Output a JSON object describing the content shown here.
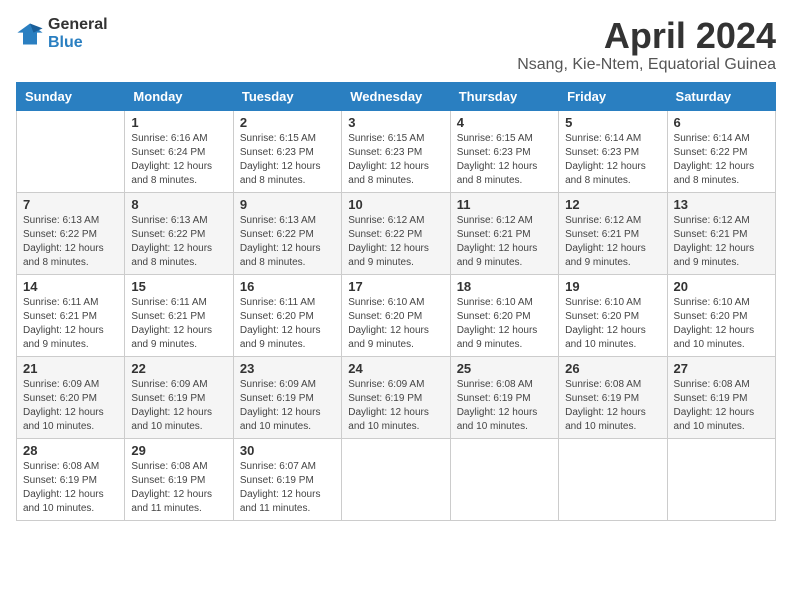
{
  "header": {
    "logo": {
      "line1": "General",
      "line2": "Blue"
    },
    "title": "April 2024",
    "location": "Nsang, Kie-Ntem, Equatorial Guinea"
  },
  "days_of_week": [
    "Sunday",
    "Monday",
    "Tuesday",
    "Wednesday",
    "Thursday",
    "Friday",
    "Saturday"
  ],
  "weeks": [
    [
      {
        "day": "",
        "info": ""
      },
      {
        "day": "1",
        "info": "Sunrise: 6:16 AM\nSunset: 6:24 PM\nDaylight: 12 hours\nand 8 minutes."
      },
      {
        "day": "2",
        "info": "Sunrise: 6:15 AM\nSunset: 6:23 PM\nDaylight: 12 hours\nand 8 minutes."
      },
      {
        "day": "3",
        "info": "Sunrise: 6:15 AM\nSunset: 6:23 PM\nDaylight: 12 hours\nand 8 minutes."
      },
      {
        "day": "4",
        "info": "Sunrise: 6:15 AM\nSunset: 6:23 PM\nDaylight: 12 hours\nand 8 minutes."
      },
      {
        "day": "5",
        "info": "Sunrise: 6:14 AM\nSunset: 6:23 PM\nDaylight: 12 hours\nand 8 minutes."
      },
      {
        "day": "6",
        "info": "Sunrise: 6:14 AM\nSunset: 6:22 PM\nDaylight: 12 hours\nand 8 minutes."
      }
    ],
    [
      {
        "day": "7",
        "info": "Sunrise: 6:13 AM\nSunset: 6:22 PM\nDaylight: 12 hours\nand 8 minutes."
      },
      {
        "day": "8",
        "info": "Sunrise: 6:13 AM\nSunset: 6:22 PM\nDaylight: 12 hours\nand 8 minutes."
      },
      {
        "day": "9",
        "info": "Sunrise: 6:13 AM\nSunset: 6:22 PM\nDaylight: 12 hours\nand 8 minutes."
      },
      {
        "day": "10",
        "info": "Sunrise: 6:12 AM\nSunset: 6:22 PM\nDaylight: 12 hours\nand 9 minutes."
      },
      {
        "day": "11",
        "info": "Sunrise: 6:12 AM\nSunset: 6:21 PM\nDaylight: 12 hours\nand 9 minutes."
      },
      {
        "day": "12",
        "info": "Sunrise: 6:12 AM\nSunset: 6:21 PM\nDaylight: 12 hours\nand 9 minutes."
      },
      {
        "day": "13",
        "info": "Sunrise: 6:12 AM\nSunset: 6:21 PM\nDaylight: 12 hours\nand 9 minutes."
      }
    ],
    [
      {
        "day": "14",
        "info": "Sunrise: 6:11 AM\nSunset: 6:21 PM\nDaylight: 12 hours\nand 9 minutes."
      },
      {
        "day": "15",
        "info": "Sunrise: 6:11 AM\nSunset: 6:21 PM\nDaylight: 12 hours\nand 9 minutes."
      },
      {
        "day": "16",
        "info": "Sunrise: 6:11 AM\nSunset: 6:20 PM\nDaylight: 12 hours\nand 9 minutes."
      },
      {
        "day": "17",
        "info": "Sunrise: 6:10 AM\nSunset: 6:20 PM\nDaylight: 12 hours\nand 9 minutes."
      },
      {
        "day": "18",
        "info": "Sunrise: 6:10 AM\nSunset: 6:20 PM\nDaylight: 12 hours\nand 9 minutes."
      },
      {
        "day": "19",
        "info": "Sunrise: 6:10 AM\nSunset: 6:20 PM\nDaylight: 12 hours\nand 10 minutes."
      },
      {
        "day": "20",
        "info": "Sunrise: 6:10 AM\nSunset: 6:20 PM\nDaylight: 12 hours\nand 10 minutes."
      }
    ],
    [
      {
        "day": "21",
        "info": "Sunrise: 6:09 AM\nSunset: 6:20 PM\nDaylight: 12 hours\nand 10 minutes."
      },
      {
        "day": "22",
        "info": "Sunrise: 6:09 AM\nSunset: 6:19 PM\nDaylight: 12 hours\nand 10 minutes."
      },
      {
        "day": "23",
        "info": "Sunrise: 6:09 AM\nSunset: 6:19 PM\nDaylight: 12 hours\nand 10 minutes."
      },
      {
        "day": "24",
        "info": "Sunrise: 6:09 AM\nSunset: 6:19 PM\nDaylight: 12 hours\nand 10 minutes."
      },
      {
        "day": "25",
        "info": "Sunrise: 6:08 AM\nSunset: 6:19 PM\nDaylight: 12 hours\nand 10 minutes."
      },
      {
        "day": "26",
        "info": "Sunrise: 6:08 AM\nSunset: 6:19 PM\nDaylight: 12 hours\nand 10 minutes."
      },
      {
        "day": "27",
        "info": "Sunrise: 6:08 AM\nSunset: 6:19 PM\nDaylight: 12 hours\nand 10 minutes."
      }
    ],
    [
      {
        "day": "28",
        "info": "Sunrise: 6:08 AM\nSunset: 6:19 PM\nDaylight: 12 hours\nand 10 minutes."
      },
      {
        "day": "29",
        "info": "Sunrise: 6:08 AM\nSunset: 6:19 PM\nDaylight: 12 hours\nand 11 minutes."
      },
      {
        "day": "30",
        "info": "Sunrise: 6:07 AM\nSunset: 6:19 PM\nDaylight: 12 hours\nand 11 minutes."
      },
      {
        "day": "",
        "info": ""
      },
      {
        "day": "",
        "info": ""
      },
      {
        "day": "",
        "info": ""
      },
      {
        "day": "",
        "info": ""
      }
    ]
  ]
}
